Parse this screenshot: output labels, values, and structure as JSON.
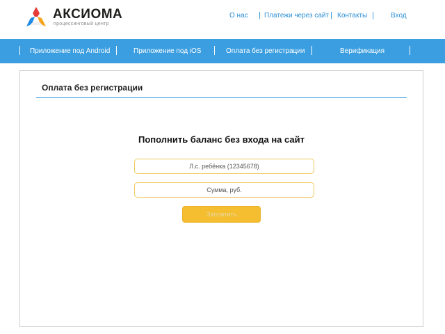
{
  "header": {
    "logo": {
      "title": "АКСИОМА",
      "subtitle": "процессинговый центр"
    },
    "nav": [
      {
        "label": "О нас"
      },
      {
        "label": "Платежи через сайт"
      },
      {
        "label": "Контакты"
      },
      {
        "label": "Вход"
      }
    ]
  },
  "menu": [
    {
      "label": "Приложение под Android"
    },
    {
      "label": "Приложение под iOS"
    },
    {
      "label": "Оплата без регистрации"
    },
    {
      "label": "Верификация"
    }
  ],
  "panel": {
    "title": "Оплата без регистрации",
    "form": {
      "title": "Пополнить баланс без входа на сайт",
      "account_placeholder": "Л.с. ребёнка (12345678)",
      "sum_placeholder": "Сумма, руб.",
      "submit_label": "Заплатить"
    }
  },
  "colors": {
    "accent_blue": "#3a9ee0",
    "link_blue": "#2b8fd6",
    "button_yellow": "#f5bd30",
    "field_border": "#f0c95a",
    "logo_red": "#e53935",
    "logo_blue": "#1e88e5",
    "logo_orange": "#f7a21b"
  }
}
